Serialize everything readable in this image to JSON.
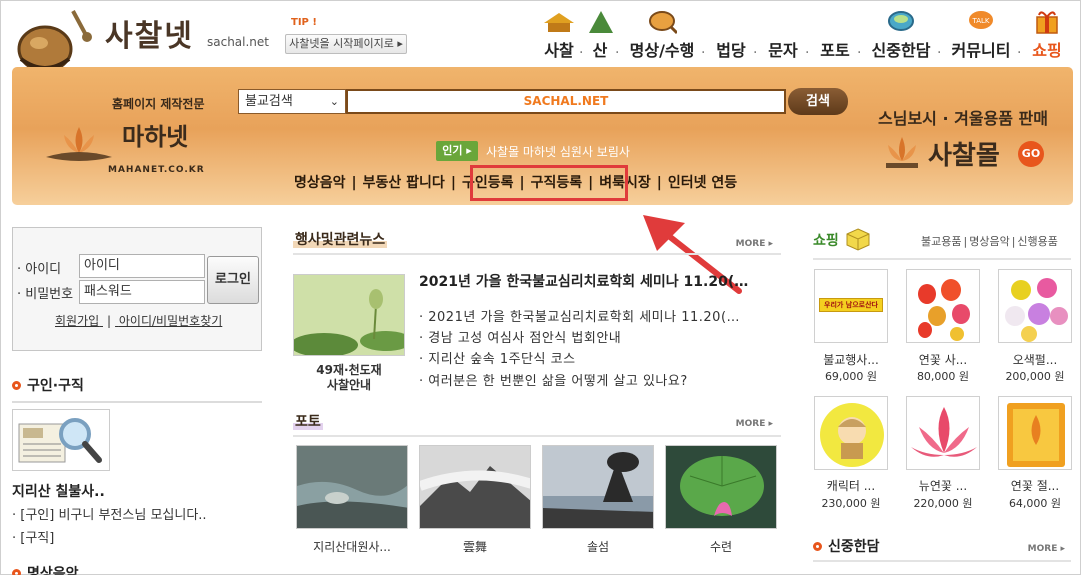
{
  "header": {
    "logo_text": "사찰넷",
    "logo_domain": "sachal.net",
    "tip_label": "TIP !",
    "tip_button": "사찰넷을 시작페이지로 ▸",
    "nav": [
      {
        "label": "사찰",
        "icon": "temple-icon"
      },
      {
        "label": "산",
        "icon": "mountain-icon"
      },
      {
        "label": "명상/수행",
        "icon": "bowl-icon"
      },
      {
        "label": "법당",
        "icon": ""
      },
      {
        "label": "문자",
        "icon": ""
      },
      {
        "label": "포토",
        "icon": ""
      },
      {
        "label": "신중한담",
        "icon": "chat-icon"
      },
      {
        "label": "커뮤니티",
        "icon": "talk-icon"
      },
      {
        "label": "쇼핑",
        "icon": "gift-icon"
      }
    ],
    "nav_sep": "·"
  },
  "band": {
    "mahanet_caption": "홈페이지 제작전문",
    "mahanet_name": "마하넷",
    "mahanet_domain": "MAHANET.CO.KR",
    "search_select": "불교검색",
    "search_value": "SACHAL.NET",
    "search_button": "검색",
    "popular_badge": "인기 ▸",
    "popular_text": "사찰몰 마하넷 심원사 보림사",
    "quicklinks": [
      "명상음악",
      "부동산 팝니다",
      "구인등록",
      "구직등록",
      "벼룩시장",
      "인터넷 연등"
    ],
    "quicklinks_sep": "|",
    "mall_title": "스님보시 · 겨울용품 판매",
    "mall_name": "사찰몰",
    "mall_go": "GO"
  },
  "login": {
    "id_label": "· 아이디",
    "pw_label": "· 비밀번호",
    "id_placeholder": "아이디",
    "pw_placeholder": "패스워드",
    "login_button": "로그인",
    "join_link": "회원가입",
    "find_link": "아이디/비밀번호찾기",
    "link_sep": "|"
  },
  "jobs": {
    "title": "구인·구직",
    "item_title": "지리산 칠불사..",
    "lines": [
      "· [구인] 비구니 부전스님 모십니다..",
      "· [구직]"
    ]
  },
  "music_title": "명상음악",
  "news": {
    "title": "행사및관련뉴스",
    "more": "MORE",
    "thumb_caption_1": "49재·천도재",
    "thumb_caption_2": "사찰안내",
    "headline": "2021년 가을 한국불교심리치료학회 세미나 11.20(…",
    "items": [
      "· 2021년 가을 한국불교심리치료학회 세미나 11.20(…",
      "· 경남 고성 여심사 점안식 법회안내",
      "· 지리산 숲속 1주단식 코스",
      "· 여러분은 한 번뿐인 삶을 어떻게 살고 있나요?"
    ]
  },
  "photo": {
    "title": "포토",
    "more": "MORE",
    "items": [
      "지리산대원사...",
      "雲舞",
      "솔섬",
      "수련"
    ]
  },
  "shop": {
    "title": "쇼핑",
    "tabs": [
      "불교용품",
      "명상음악",
      "신행용품"
    ],
    "tab_sep": "|",
    "banner_text": "우리가 남으로산다",
    "products": [
      {
        "name": "불교행사...",
        "price": "69,000 원"
      },
      {
        "name": "연꽃 사...",
        "price": "80,000 원"
      },
      {
        "name": "오색펄...",
        "price": "200,000 원"
      },
      {
        "name": "캐릭터 ...",
        "price": "230,000 원"
      },
      {
        "name": "뉴연꽃 ...",
        "price": "220,000 원"
      },
      {
        "name": "연꽃 절...",
        "price": "64,000 원"
      }
    ]
  },
  "sinjung": {
    "title": "신중한담",
    "more": "MORE"
  },
  "colors": {
    "accent": "#e8561c",
    "band": "#e8a25a",
    "highlight": "#e03b3b",
    "popular": "#6aa63a"
  }
}
